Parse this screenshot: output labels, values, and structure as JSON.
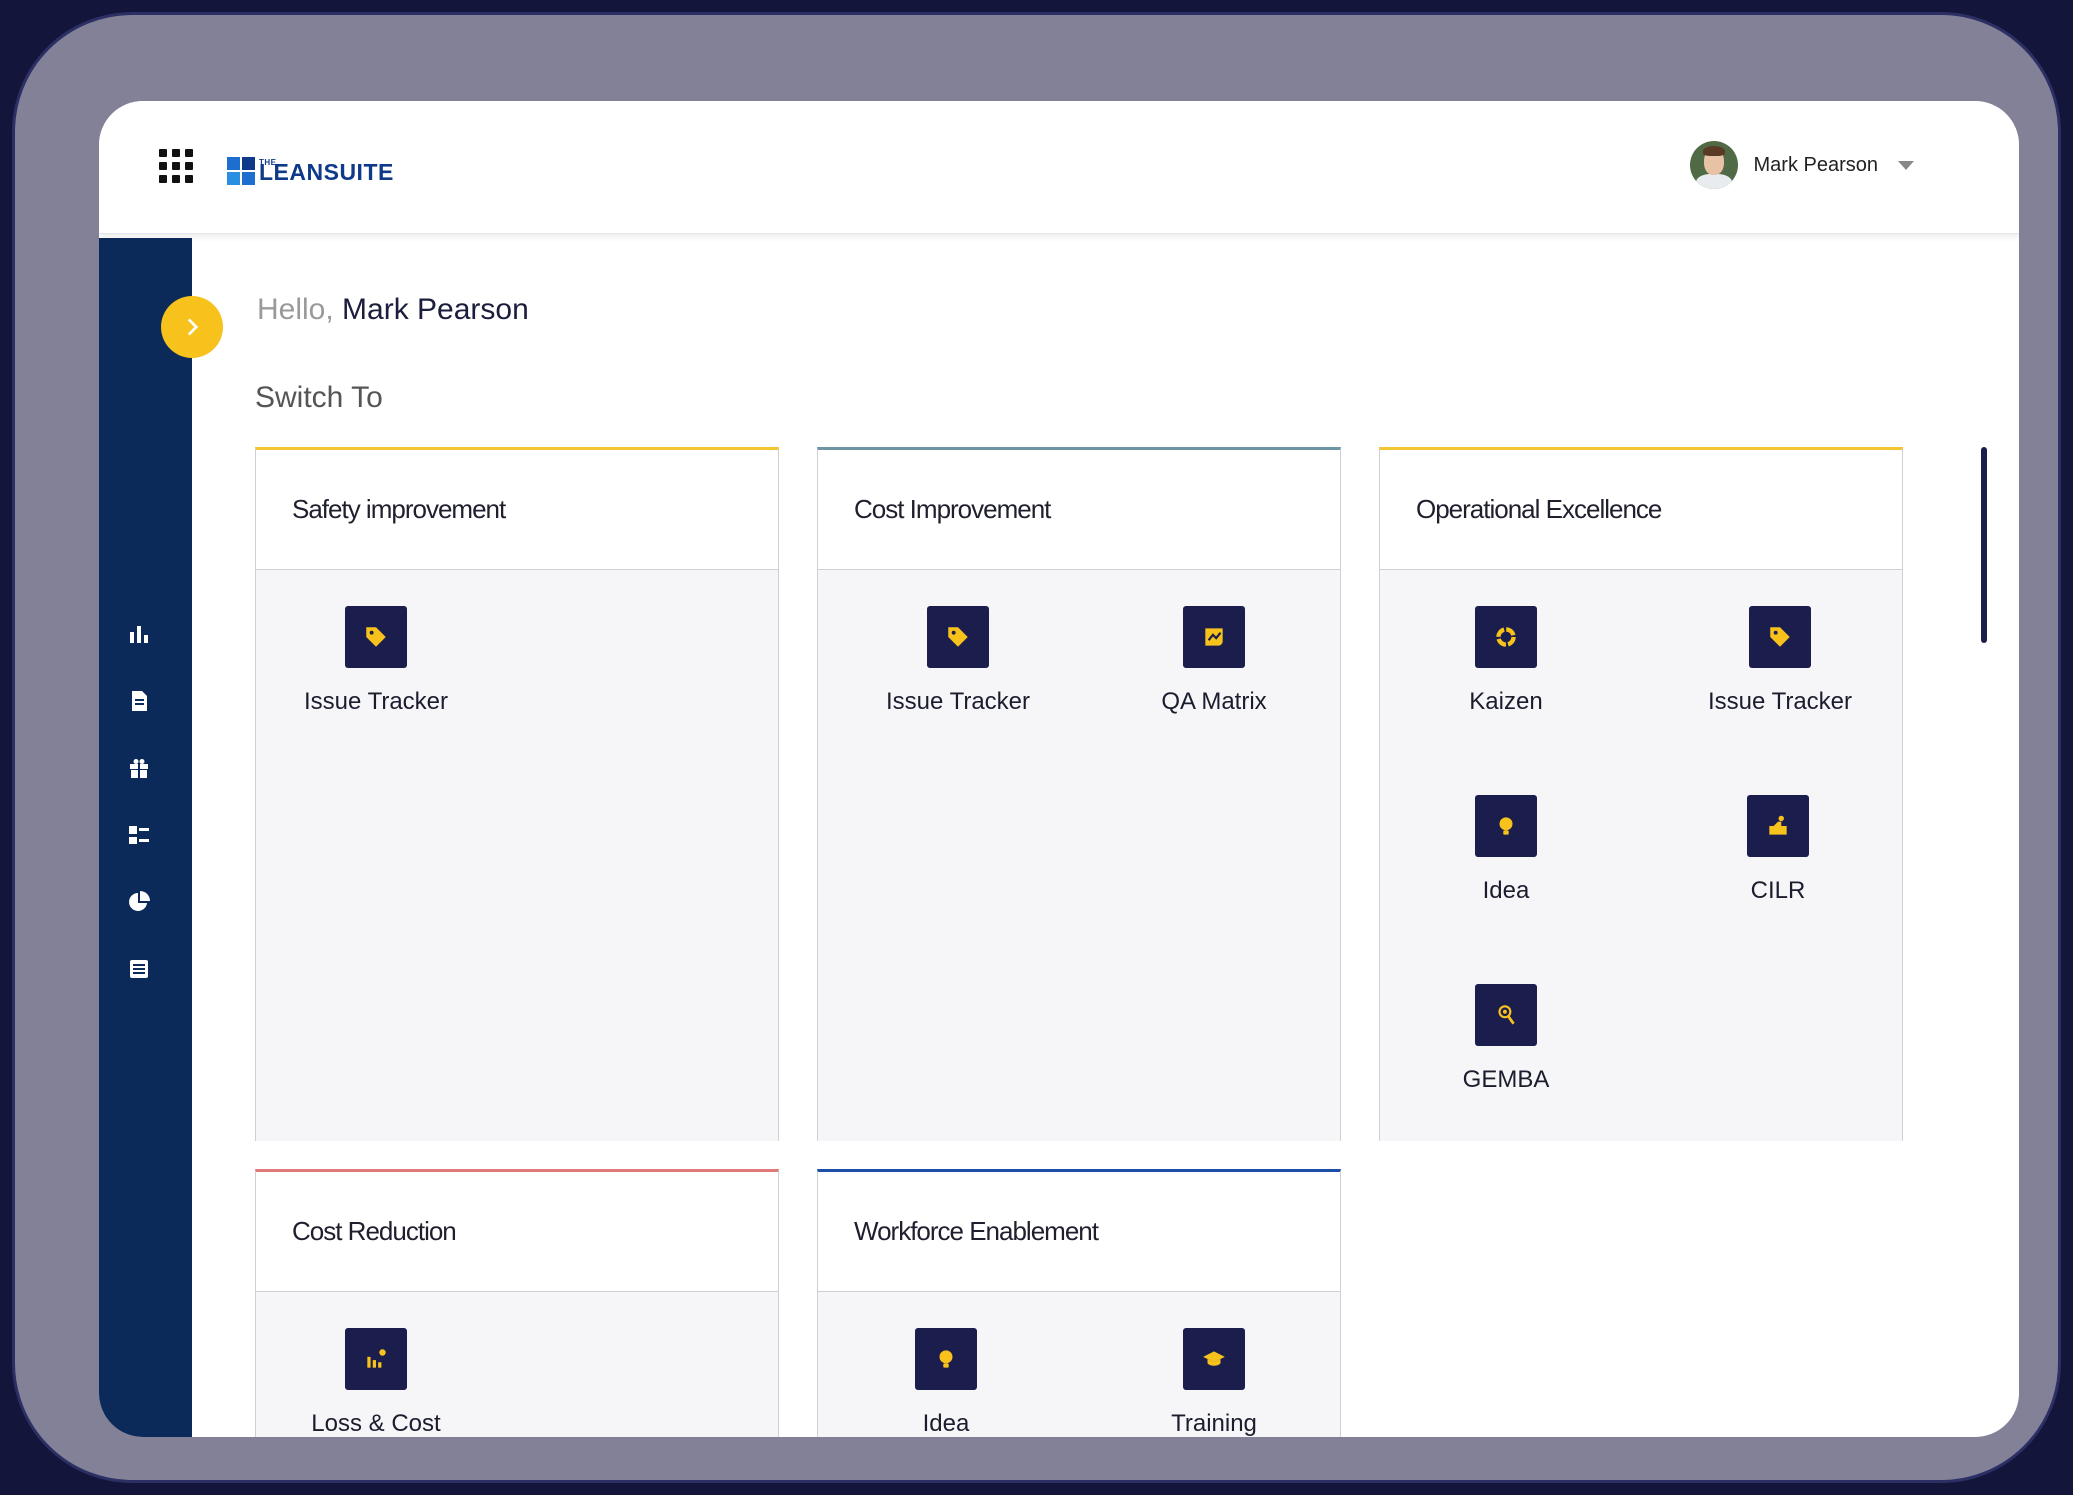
{
  "header": {
    "logo_the": "THE",
    "logo_text": "LEANSUITE",
    "user_name": "Mark Pearson"
  },
  "greeting": {
    "hello": "Hello,",
    "name": "Mark Pearson"
  },
  "switch_title": "Switch To",
  "sidebar_icons": [
    "bar-chart-icon",
    "document-icon",
    "gift-icon",
    "checklist-icon",
    "pie-chart-icon",
    "list-icon"
  ],
  "colors": {
    "accent": "#f7c21b",
    "sidebar": "#0b2a5a",
    "app_tile": "#1b1d4c"
  },
  "cards": [
    {
      "title": "Safety improvement",
      "accent": "#f2c530",
      "apps": [
        {
          "label": "Issue Tracker",
          "icon": "tag-icon"
        }
      ]
    },
    {
      "title": "Cost Improvement",
      "accent": "#6e95a3",
      "apps": [
        {
          "label": "Issue Tracker",
          "icon": "tag-icon"
        },
        {
          "label": "QA Matrix",
          "icon": "chart-badge-icon"
        }
      ]
    },
    {
      "title": "Operational Excellence",
      "accent": "#f2c530",
      "apps": [
        {
          "label": "Kaizen",
          "icon": "cycle-icon"
        },
        {
          "label": "Issue Tracker",
          "icon": "tag-icon"
        },
        {
          "label": "Idea",
          "icon": "lightbulb-icon"
        },
        {
          "label": "CILR",
          "icon": "hand-icon"
        },
        {
          "label": "GEMBA",
          "icon": "eye-search-icon"
        }
      ]
    },
    {
      "title": "Cost Reduction",
      "accent": "#e07a7a",
      "apps": [
        {
          "label": "Loss & Cost",
          "icon": "loss-chart-icon"
        }
      ]
    },
    {
      "title": "Workforce Enablement",
      "accent": "#1e4fa8",
      "apps": [
        {
          "label": "Idea",
          "icon": "lightbulb-icon"
        },
        {
          "label": "Training",
          "icon": "graduation-cap-icon"
        }
      ]
    }
  ]
}
